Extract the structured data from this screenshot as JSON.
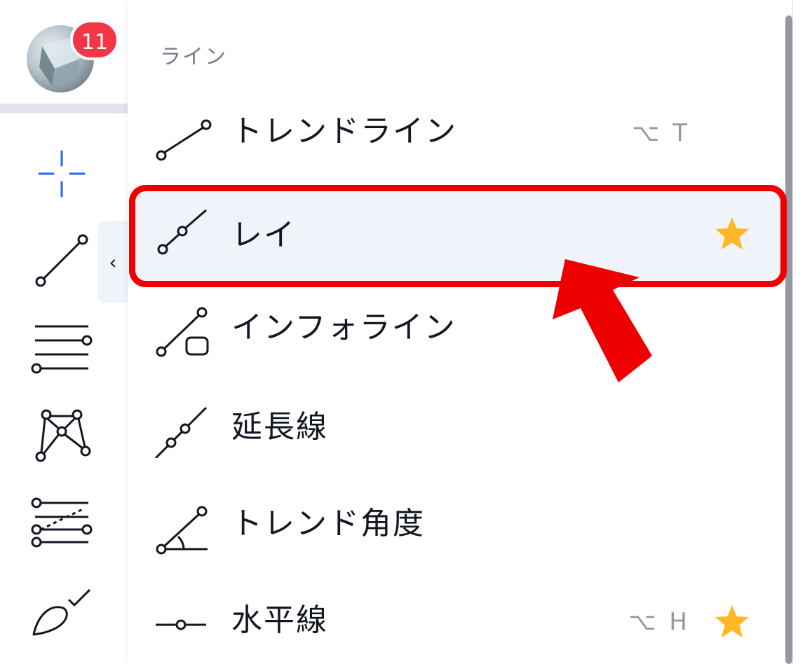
{
  "avatar": {
    "badge_count": "11"
  },
  "toolbar": {
    "tools": [
      "crosshair-icon",
      "trendline-tool-icon",
      "horizontal-lines-tool-icon",
      "pattern-tool-icon",
      "fib-tool-icon",
      "brush-tool-icon"
    ],
    "collapse_glyph": "‹"
  },
  "menu": {
    "section_title": "ライン",
    "items": [
      {
        "label": "トレンドライン",
        "shortcut": "⌥ T",
        "favorite": false,
        "icon": "trend-line-icon"
      },
      {
        "label": "レイ",
        "shortcut": "",
        "favorite": true,
        "icon": "ray-icon",
        "selected": true
      },
      {
        "label": "インフォライン",
        "shortcut": "",
        "favorite": false,
        "icon": "info-line-icon"
      },
      {
        "label": "延長線",
        "shortcut": "",
        "favorite": false,
        "icon": "extended-line-icon"
      },
      {
        "label": "トレンド角度",
        "shortcut": "",
        "favorite": false,
        "icon": "trend-angle-icon"
      },
      {
        "label": "水平線",
        "shortcut": "⌥ H",
        "favorite": true,
        "icon": "horizontal-line-icon"
      }
    ]
  },
  "colors": {
    "star": "#ffb728",
    "highlight": "#ee0000",
    "selected_bg": "#f0f3fa",
    "badge": "#f23645",
    "crosshair": "#2962ff"
  }
}
